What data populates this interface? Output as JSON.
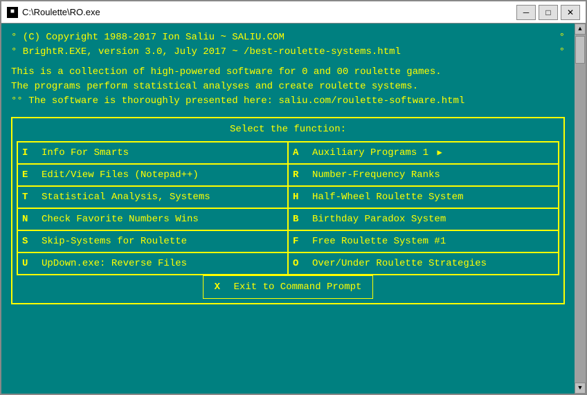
{
  "window": {
    "title": "C:\\Roulette\\RO.exe",
    "icon": "■"
  },
  "title_buttons": {
    "minimize": "─",
    "maximize": "□",
    "close": "✕"
  },
  "header": {
    "line1_left": "° (C) Copyright 1988-2017 Ion Saliu ~ SALIU.COM",
    "line1_right": "°",
    "line2_left": "° BrightR.EXE, version 3.0, July 2017 ~ /best-roulette-systems.html",
    "line2_right": "°"
  },
  "description": {
    "line1": "This is a collection of high-powered software for 0 and 00 roulette games.",
    "line2": "The programs perform statistical analyses and create roulette systems.",
    "line3": "°° The software is thoroughly presented here: saliu.com/roulette-software.html"
  },
  "menu": {
    "title": "Select the function:",
    "items_left": [
      {
        "key": "I",
        "label": "Info For Smarts"
      },
      {
        "key": "E",
        "label": "Edit/View Files (Notepad++)"
      },
      {
        "key": "T",
        "label": "Statistical Analysis, Systems"
      },
      {
        "key": "N",
        "label": "Check Favorite Numbers Wins"
      },
      {
        "key": "S",
        "label": "Skip-Systems for Roulette"
      },
      {
        "key": "U",
        "label": "UpDown.exe: Reverse Files"
      }
    ],
    "items_right": [
      {
        "key": "A",
        "label": "Auxiliary Programs 1",
        "arrow": true
      },
      {
        "key": "R",
        "label": "Number-Frequency Ranks"
      },
      {
        "key": "H",
        "label": "Half-Wheel Roulette System"
      },
      {
        "key": "B",
        "label": "Birthday Paradox System"
      },
      {
        "key": "F",
        "label": "Free Roulette System #1"
      },
      {
        "key": "O",
        "label": "Over/Under Roulette Strategies"
      }
    ],
    "exit": {
      "key": "X",
      "label": "Exit to Command Prompt"
    }
  }
}
